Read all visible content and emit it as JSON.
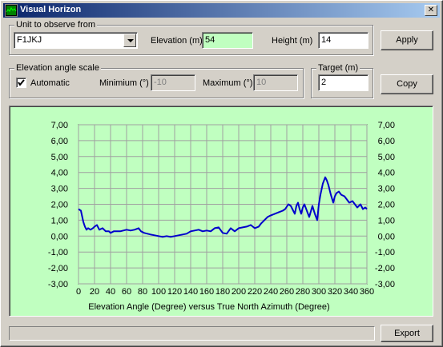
{
  "window": {
    "title": "Visual Horizon",
    "close_label": "✕",
    "app_icon": "waveform-icon"
  },
  "observe": {
    "legend": "Unit to observe from",
    "unit_value": "F1JKJ",
    "elevation_label": "Elevation (m)",
    "elevation_value": "54",
    "height_label": "Height (m)",
    "height_value": "14"
  },
  "scale": {
    "legend": "Elevation angle scale",
    "automatic_label": "Automatic",
    "automatic_checked": true,
    "minimum_label": "Minimium (°)",
    "minimum_value": "-10",
    "maximum_label": "Maximum (°)",
    "maximum_value": "10"
  },
  "target": {
    "legend": "Target (m)",
    "value": "2"
  },
  "buttons": {
    "apply": "Apply",
    "copy": "Copy",
    "export": "Export"
  },
  "colors": {
    "chart_background": "#c0ffc0",
    "line": "#0000cc",
    "grid": "#a0a0a0"
  },
  "chart_data": {
    "type": "line",
    "xlabel": "Elevation Angle (Degree) versus True North Azimuth (Degree)",
    "ylabel": "",
    "xlim": [
      0,
      360
    ],
    "ylim": [
      -3,
      7
    ],
    "x_ticks": [
      "0",
      "20",
      "40",
      "60",
      "80",
      "100",
      "120",
      "140",
      "160",
      "180",
      "200",
      "220",
      "240",
      "260",
      "280",
      "300",
      "320",
      "340",
      "360"
    ],
    "y_ticks": [
      "7,00",
      "6,00",
      "5,00",
      "4,00",
      "3,00",
      "2,00",
      "1,00",
      "0,00",
      "-1,00",
      "-2,00",
      "-3,00"
    ],
    "y_tick_values": [
      7,
      6,
      5,
      4,
      3,
      2,
      1,
      0,
      -1,
      -2,
      -3
    ],
    "grid": true,
    "series": [
      {
        "x": [
          0,
          3,
          6,
          8,
          10,
          12,
          15,
          18,
          20,
          23,
          26,
          30,
          34,
          38,
          40,
          44,
          48,
          52,
          56,
          60,
          65,
          70,
          75,
          78,
          82,
          86,
          90,
          95,
          100,
          105,
          110,
          115,
          120,
          125,
          130,
          135,
          140,
          145,
          150,
          155,
          160,
          165,
          170,
          175,
          180,
          185,
          190,
          195,
          200,
          205,
          210,
          215,
          220,
          225,
          228,
          232,
          236,
          240,
          245,
          250,
          255,
          258,
          262,
          265,
          268,
          270,
          272,
          274,
          276,
          278,
          280,
          282,
          285,
          288,
          292,
          295,
          298,
          300,
          302,
          305,
          308,
          310,
          312,
          315,
          318,
          320,
          322,
          325,
          328,
          332,
          335,
          338,
          342,
          345,
          348,
          350,
          352,
          355,
          358,
          360
        ],
        "values": [
          1.7,
          1.6,
          0.9,
          0.6,
          0.4,
          0.5,
          0.4,
          0.5,
          0.6,
          0.7,
          0.4,
          0.5,
          0.3,
          0.3,
          0.2,
          0.3,
          0.3,
          0.3,
          0.35,
          0.4,
          0.35,
          0.4,
          0.5,
          0.3,
          0.2,
          0.15,
          0.1,
          0.05,
          0.0,
          -0.05,
          0.0,
          -0.05,
          0.0,
          0.05,
          0.1,
          0.15,
          0.3,
          0.35,
          0.4,
          0.3,
          0.35,
          0.3,
          0.5,
          0.55,
          0.2,
          0.15,
          0.5,
          0.3,
          0.5,
          0.55,
          0.6,
          0.7,
          0.5,
          0.6,
          0.8,
          1.0,
          1.2,
          1.3,
          1.4,
          1.5,
          1.6,
          1.7,
          2.0,
          1.9,
          1.6,
          1.4,
          1.9,
          2.1,
          1.7,
          1.4,
          1.8,
          2.0,
          1.6,
          1.2,
          1.9,
          1.4,
          1.0,
          2.0,
          2.6,
          3.3,
          3.7,
          3.5,
          3.2,
          2.6,
          2.1,
          2.5,
          2.7,
          2.8,
          2.6,
          2.5,
          2.3,
          2.1,
          2.2,
          2.0,
          1.8,
          1.9,
          2.0,
          1.7,
          1.8,
          1.7
        ]
      }
    ]
  }
}
